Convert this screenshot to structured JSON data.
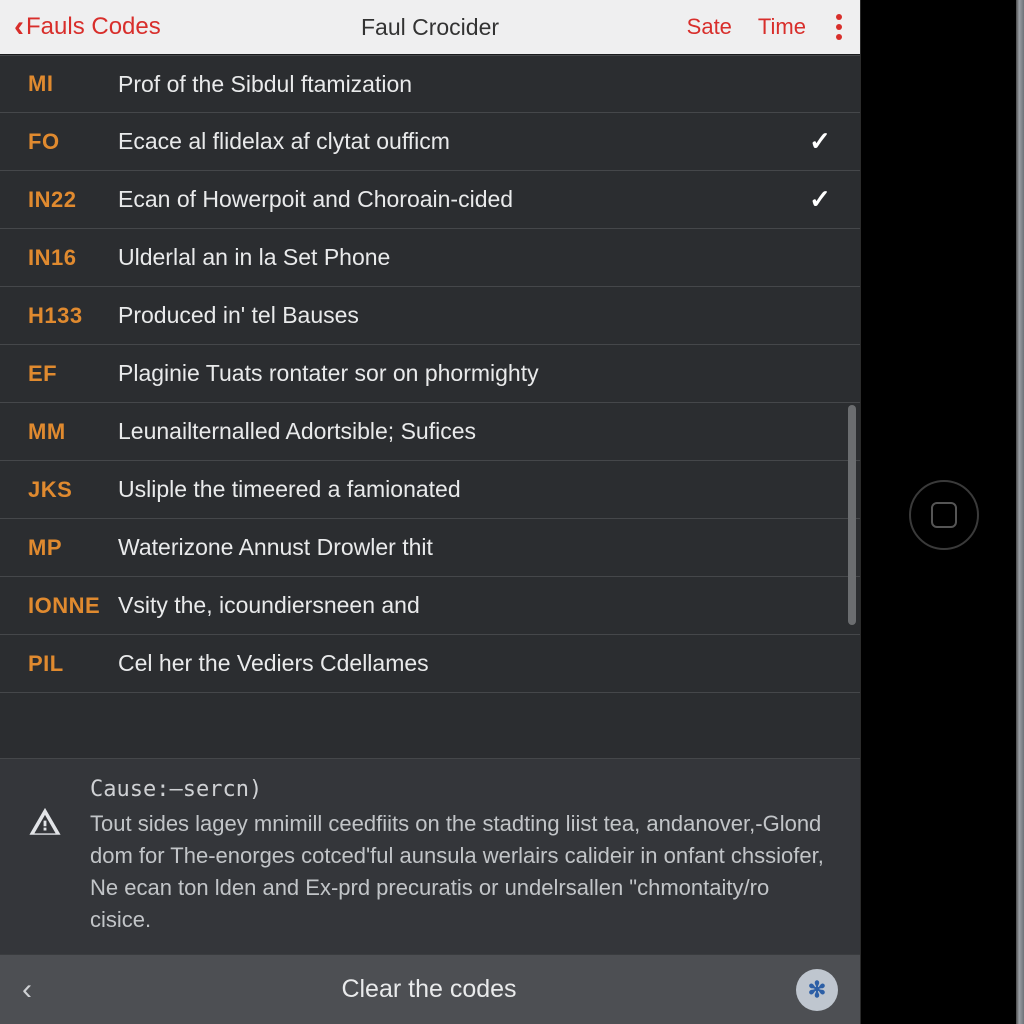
{
  "topbar": {
    "back_label": "Fauls Codes",
    "title": "Faul Crocider",
    "right1": "Sate",
    "right2": "Time"
  },
  "rows": [
    {
      "code": "MI",
      "desc": "Prof of the Sibdul ftamization",
      "checked": false
    },
    {
      "code": "FO",
      "desc": "Ecace al flidelax af clytat oufficm",
      "checked": true
    },
    {
      "code": "IN22",
      "desc": "Ecan of Howerpoit and Choroain-cided",
      "checked": true
    },
    {
      "code": "IN16",
      "desc": "Ulderlal an in la Set Phone",
      "checked": false
    },
    {
      "code": "H133",
      "desc": "Produced in' tel Bauses",
      "checked": false
    },
    {
      "code": "EF",
      "desc": "Plaginie Tuats rontater sor on phormighty",
      "checked": false
    },
    {
      "code": "MM",
      "desc": "Leunailternalled Adortsible; Sufices",
      "checked": false
    },
    {
      "code": "JKS",
      "desc": "Usliple the timeered a famionated",
      "checked": false
    },
    {
      "code": "MP",
      "desc": "Waterizone Annust Drowler thit",
      "checked": false
    },
    {
      "code": "IONNE",
      "desc": "Vsity the, icoundiersneen and",
      "checked": false
    },
    {
      "code": "PIL",
      "desc": "Cel her the Vediers Cdellames",
      "checked": false
    }
  ],
  "cause": {
    "label": "Cause:—sercn)",
    "body": "Tout sides lagey mnimill ceedfiits on the stadting liist tea, andanover,-Glond dom for The-enorges cotced'ful aunsula werlairs calideir in onfant chssiofer, Ne ecan ton lden and Ex-prd precuratis or undelrsallen \"chmontaity/ro cisice."
  },
  "bottombar": {
    "label": "Clear the codes"
  }
}
